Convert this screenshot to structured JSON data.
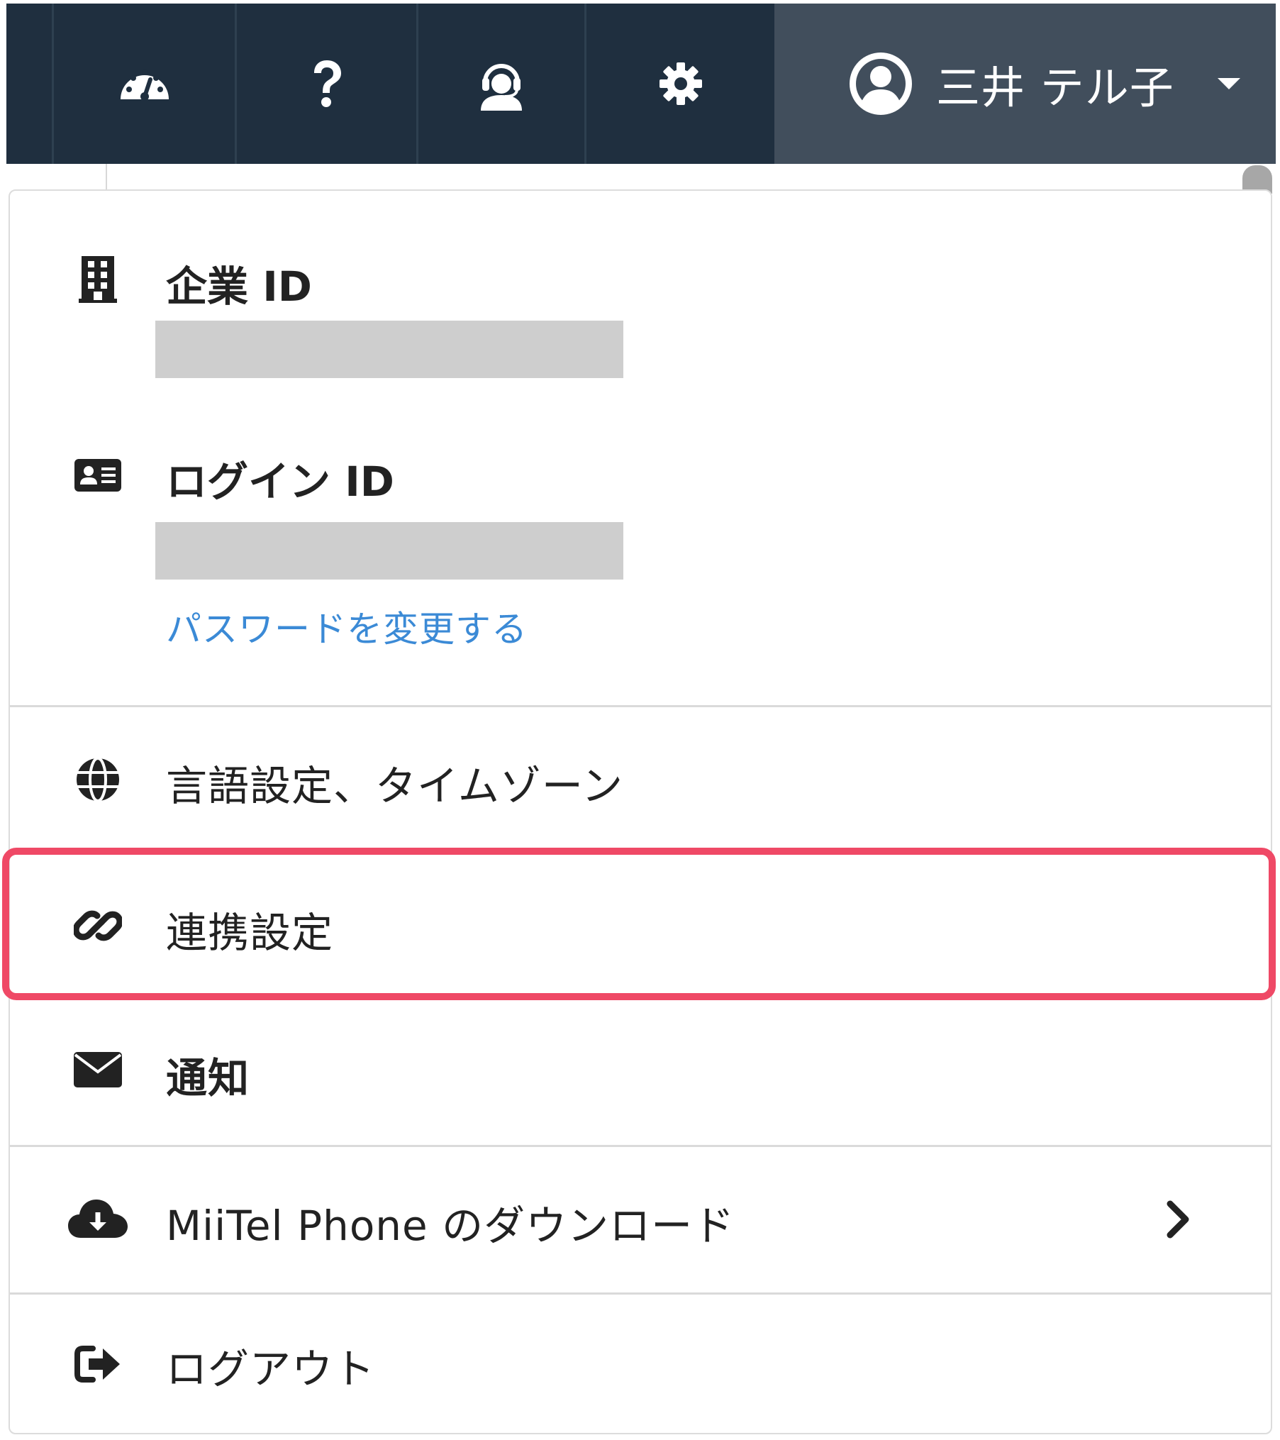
{
  "header": {
    "nav_icons": [
      "dashboard-gauge-icon",
      "help-question-icon",
      "support-headset-icon",
      "settings-gear-icon"
    ],
    "user": {
      "name": "三井 テル子",
      "avatar_icon": "user-circle-icon",
      "dropdown_icon": "caret-down-icon"
    }
  },
  "menu": {
    "company_id": {
      "icon": "building-icon",
      "label": "企業 ID",
      "value_redacted": true
    },
    "login_id": {
      "icon": "id-card-icon",
      "label": "ログイン ID",
      "value_redacted": true,
      "change_password_link": "パスワードを変更する"
    },
    "items": [
      {
        "icon": "globe-icon",
        "label": "言語設定、タイムゾーン"
      },
      {
        "icon": "link-icon",
        "label": "連携設定",
        "highlighted": true
      },
      {
        "icon": "envelope-icon",
        "label": "通知"
      },
      {
        "icon": "cloud-download-icon",
        "label": "MiiTel Phone のダウンロード",
        "submenu_icon": "chevron-right-icon"
      },
      {
        "icon": "sign-out-icon",
        "label": "ログアウト"
      }
    ]
  },
  "colors": {
    "topbar_bg": "#1f2f3f",
    "user_menu_bg": "#414e5c",
    "link": "#3b8ad6",
    "highlight_border": "#ef4966",
    "redaction": "#cecece"
  }
}
